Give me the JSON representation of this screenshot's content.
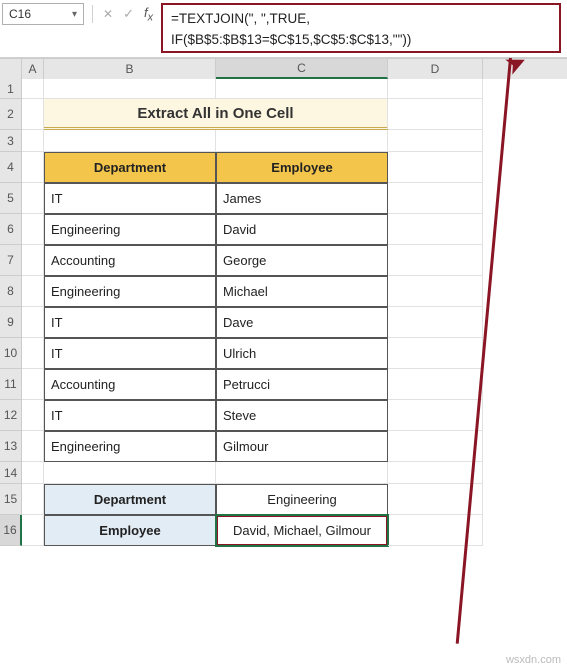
{
  "namebox": "C16",
  "formula_line1": "=TEXTJOIN(\", \",TRUE,",
  "formula_line2": "IF($B$5:$B$13=$C$15,$C$5:$C$13,\"\"))",
  "col_labels": [
    "",
    "A",
    "B",
    "C",
    "D"
  ],
  "row_labels": [
    "1",
    "2",
    "3",
    "4",
    "5",
    "6",
    "7",
    "8",
    "9",
    "10",
    "11",
    "12",
    "13",
    "14",
    "15",
    "16"
  ],
  "title": "Extract All in One Cell",
  "table_headers": {
    "dept": "Department",
    "emp": "Employee"
  },
  "table_rows": [
    {
      "dept": "IT",
      "emp": "James"
    },
    {
      "dept": "Engineering",
      "emp": "David"
    },
    {
      "dept": "Accounting",
      "emp": "George"
    },
    {
      "dept": "Engineering",
      "emp": "Michael"
    },
    {
      "dept": "IT",
      "emp": "Dave"
    },
    {
      "dept": "IT",
      "emp": "Ulrich"
    },
    {
      "dept": "Accounting",
      "emp": "Petrucci"
    },
    {
      "dept": "IT",
      "emp": "Steve"
    },
    {
      "dept": "Engineering",
      "emp": "Gilmour"
    }
  ],
  "filter": {
    "dept_label": "Department",
    "dept_value": "Engineering",
    "emp_label": "Employee",
    "emp_value": "David, Michael, Gilmour"
  },
  "watermark": "wsxdn.com"
}
